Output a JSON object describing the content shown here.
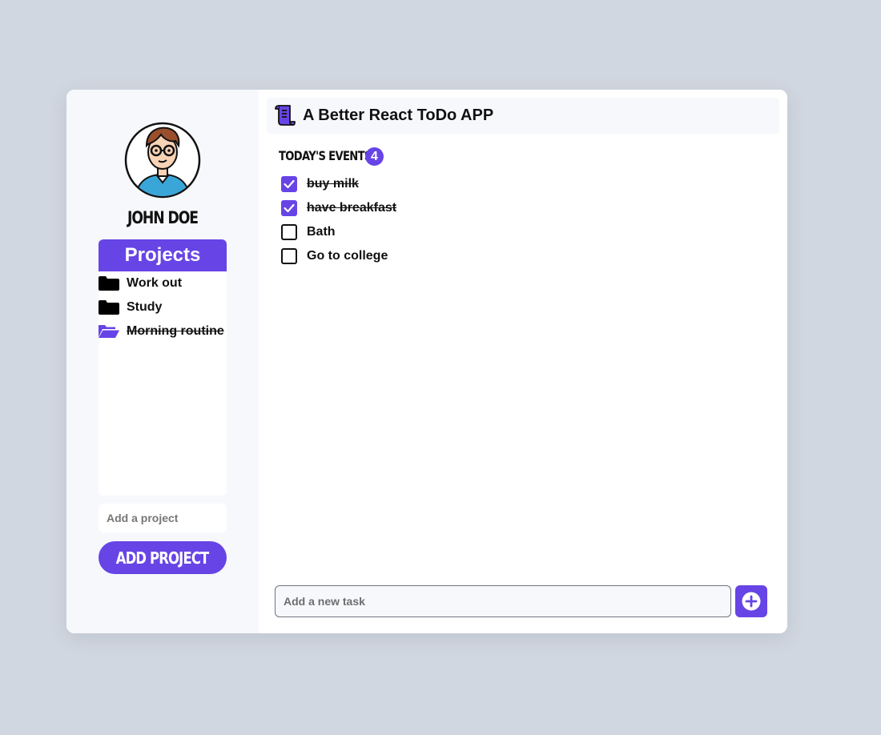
{
  "colors": {
    "accent": "#6744e6",
    "page_background": "#d1d7e0",
    "sidebar_background": "#f7f8fc",
    "card_background": "#ffffff"
  },
  "user": {
    "name": "JOHN DOE",
    "avatar_icon": "user-avatar-icon"
  },
  "sidebar": {
    "projects_title": "Projects",
    "projects": [
      {
        "label": "Work out",
        "icon": "folder-icon",
        "done": false
      },
      {
        "label": "Study",
        "icon": "folder-icon",
        "done": false
      },
      {
        "label": "Morning routine",
        "icon": "folder-open-icon",
        "done": true
      }
    ],
    "add_project_placeholder": "Add a project",
    "add_project_button": "ADD PROJECT"
  },
  "header": {
    "logo_icon": "scroll-icon",
    "title": "A Better React ToDo APP"
  },
  "events": {
    "heading": "TODAY'S EVENTS",
    "count": "4",
    "tasks": [
      {
        "label": "buy milk",
        "checked": true
      },
      {
        "label": "have breakfast",
        "checked": true
      },
      {
        "label": "Bath",
        "checked": false
      },
      {
        "label": "Go to college",
        "checked": false
      }
    ]
  },
  "new_task": {
    "placeholder": "Add a new task",
    "add_icon": "plus-circle-icon"
  }
}
